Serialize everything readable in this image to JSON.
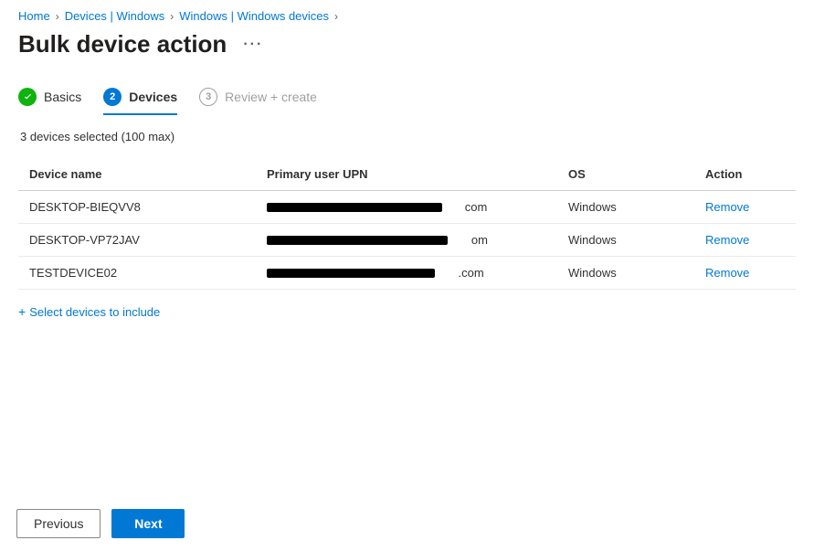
{
  "breadcrumb": {
    "items": [
      {
        "label": "Home"
      },
      {
        "label": "Devices | Windows"
      },
      {
        "label": "Windows | Windows devices"
      }
    ]
  },
  "page": {
    "title": "Bulk device action",
    "more": "…"
  },
  "wizard": {
    "steps": [
      {
        "label": "Basics",
        "state": "complete"
      },
      {
        "num": "2",
        "label": "Devices",
        "state": "current"
      },
      {
        "num": "3",
        "label": "Review + create",
        "state": "future"
      }
    ]
  },
  "summary": "3 devices selected (100 max)",
  "table": {
    "headers": {
      "device": "Device name",
      "upn": "Primary user UPN",
      "os": "OS",
      "action": "Action"
    },
    "rows": [
      {
        "device": "DESKTOP-BIEQVV8",
        "upn_suffix": "com",
        "redact_width": 192,
        "os": "Windows",
        "action": "Remove"
      },
      {
        "device": "DESKTOP-VP72JAV",
        "upn_suffix": "om",
        "redact_width": 198,
        "os": "Windows",
        "action": "Remove"
      },
      {
        "device": "TESTDEVICE02",
        "upn_suffix": ".com",
        "redact_width": 184,
        "os": "Windows",
        "action": "Remove"
      }
    ]
  },
  "selectLink": "Select devices to include",
  "footer": {
    "previous": "Previous",
    "next": "Next"
  }
}
